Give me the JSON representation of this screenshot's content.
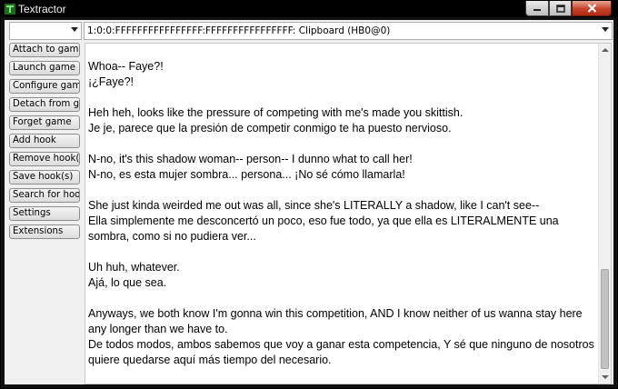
{
  "window": {
    "title": "Textractor",
    "icon": "textractor-app-icon",
    "controls": [
      "minimize-icon",
      "maximize-icon",
      "close-icon"
    ]
  },
  "process_select": {
    "value": ""
  },
  "hook_select": {
    "value": "1:0:0:FFFFFFFFFFFFFFFF:FFFFFFFFFFFFFFFF: Clipboard (HB0@0)"
  },
  "sidebar": {
    "buttons": [
      {
        "label": "Attach to game"
      },
      {
        "label": "Launch game"
      },
      {
        "label": "Configure game"
      },
      {
        "label": "Detach from game"
      },
      {
        "label": "Forget game"
      },
      {
        "label": "Add hook"
      },
      {
        "label": "Remove hook(s)"
      },
      {
        "label": "Save hook(s)"
      },
      {
        "label": "Search for hooks"
      },
      {
        "label": "Settings"
      },
      {
        "label": "Extensions"
      }
    ]
  },
  "text_output": {
    "blocks": [
      {
        "en": "Whoa-- Faye?!",
        "es": "¡¿Faye?!"
      },
      {
        "en": "Heh heh, looks like the pressure of competing with me's made you skittish.",
        "es": "Je je, parece que la presión de competir conmigo te ha puesto nervioso."
      },
      {
        "en": "N-no, it's this shadow woman-- person-- I dunno what to call her!",
        "es": "N-no, es esta mujer sombra... persona... ¡No sé cómo llamarla!"
      },
      {
        "en": "She just kinda weirded me out was all, since she's LITERALLY a shadow, like I can't see--",
        "es": "Ella simplemente me desconcertó un poco, eso fue todo, ya que ella es LITERALMENTE una sombra, como si no pudiera ver..."
      },
      {
        "en": "Uh huh, whatever.",
        "es": "Ajá, lo que sea."
      },
      {
        "en": "Anyways, we both know I'm gonna win this competition, AND I know neither of us wanna stay here any longer than we have to.",
        "es": "De todos modos, ambos sabemos que voy a ganar esta competencia, Y sé que ninguno de nosotros quiere quedarse aquí más tiempo del necesario."
      }
    ]
  },
  "colors": {
    "titlebar": "#000000",
    "client_bg": "#f0f0f0",
    "close_button": "#c7432b",
    "text": "#000000"
  }
}
